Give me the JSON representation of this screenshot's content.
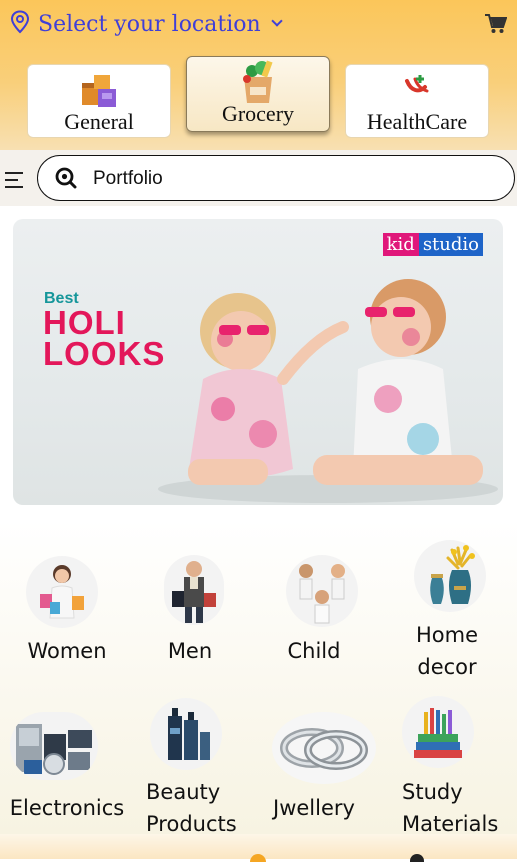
{
  "header": {
    "location_label": "Select your location",
    "accent_color": "#3f3fd8",
    "background_color": "#fbc65a",
    "cart_icon": "cart-icon"
  },
  "tabs": [
    {
      "label": "General",
      "icon": "boxes-icon",
      "active": false
    },
    {
      "label": "Grocery",
      "icon": "grocery-bag-icon",
      "active": true
    },
    {
      "label": "HealthCare",
      "icon": "healthcare-icon",
      "active": false
    }
  ],
  "search": {
    "value": "Portfolio",
    "icon": "search-icon"
  },
  "banner": {
    "brand_kid": "kid",
    "brand_studio": "studio",
    "tagline_small": "Best",
    "tagline_line1": "HOLI",
    "tagline_line2": "LOOKS",
    "tagline_color": "#e3175a"
  },
  "categories": [
    {
      "label": "Women",
      "icon": "women-shopping-icon"
    },
    {
      "label": "Men",
      "icon": "men-fashion-icon"
    },
    {
      "label": "Child",
      "icon": "children-icon"
    },
    {
      "label_line1": "Home",
      "label_line2": "decor",
      "icon": "home-decor-icon"
    },
    {
      "label": "Electronics",
      "icon": "electronics-icon"
    },
    {
      "label_line1": "Beauty",
      "label_line2": "Products",
      "icon": "beauty-products-icon"
    },
    {
      "label": "Jwellery",
      "icon": "rings-icon"
    },
    {
      "label_line1": "Study",
      "label_line2": "Materials",
      "icon": "books-icon"
    }
  ]
}
